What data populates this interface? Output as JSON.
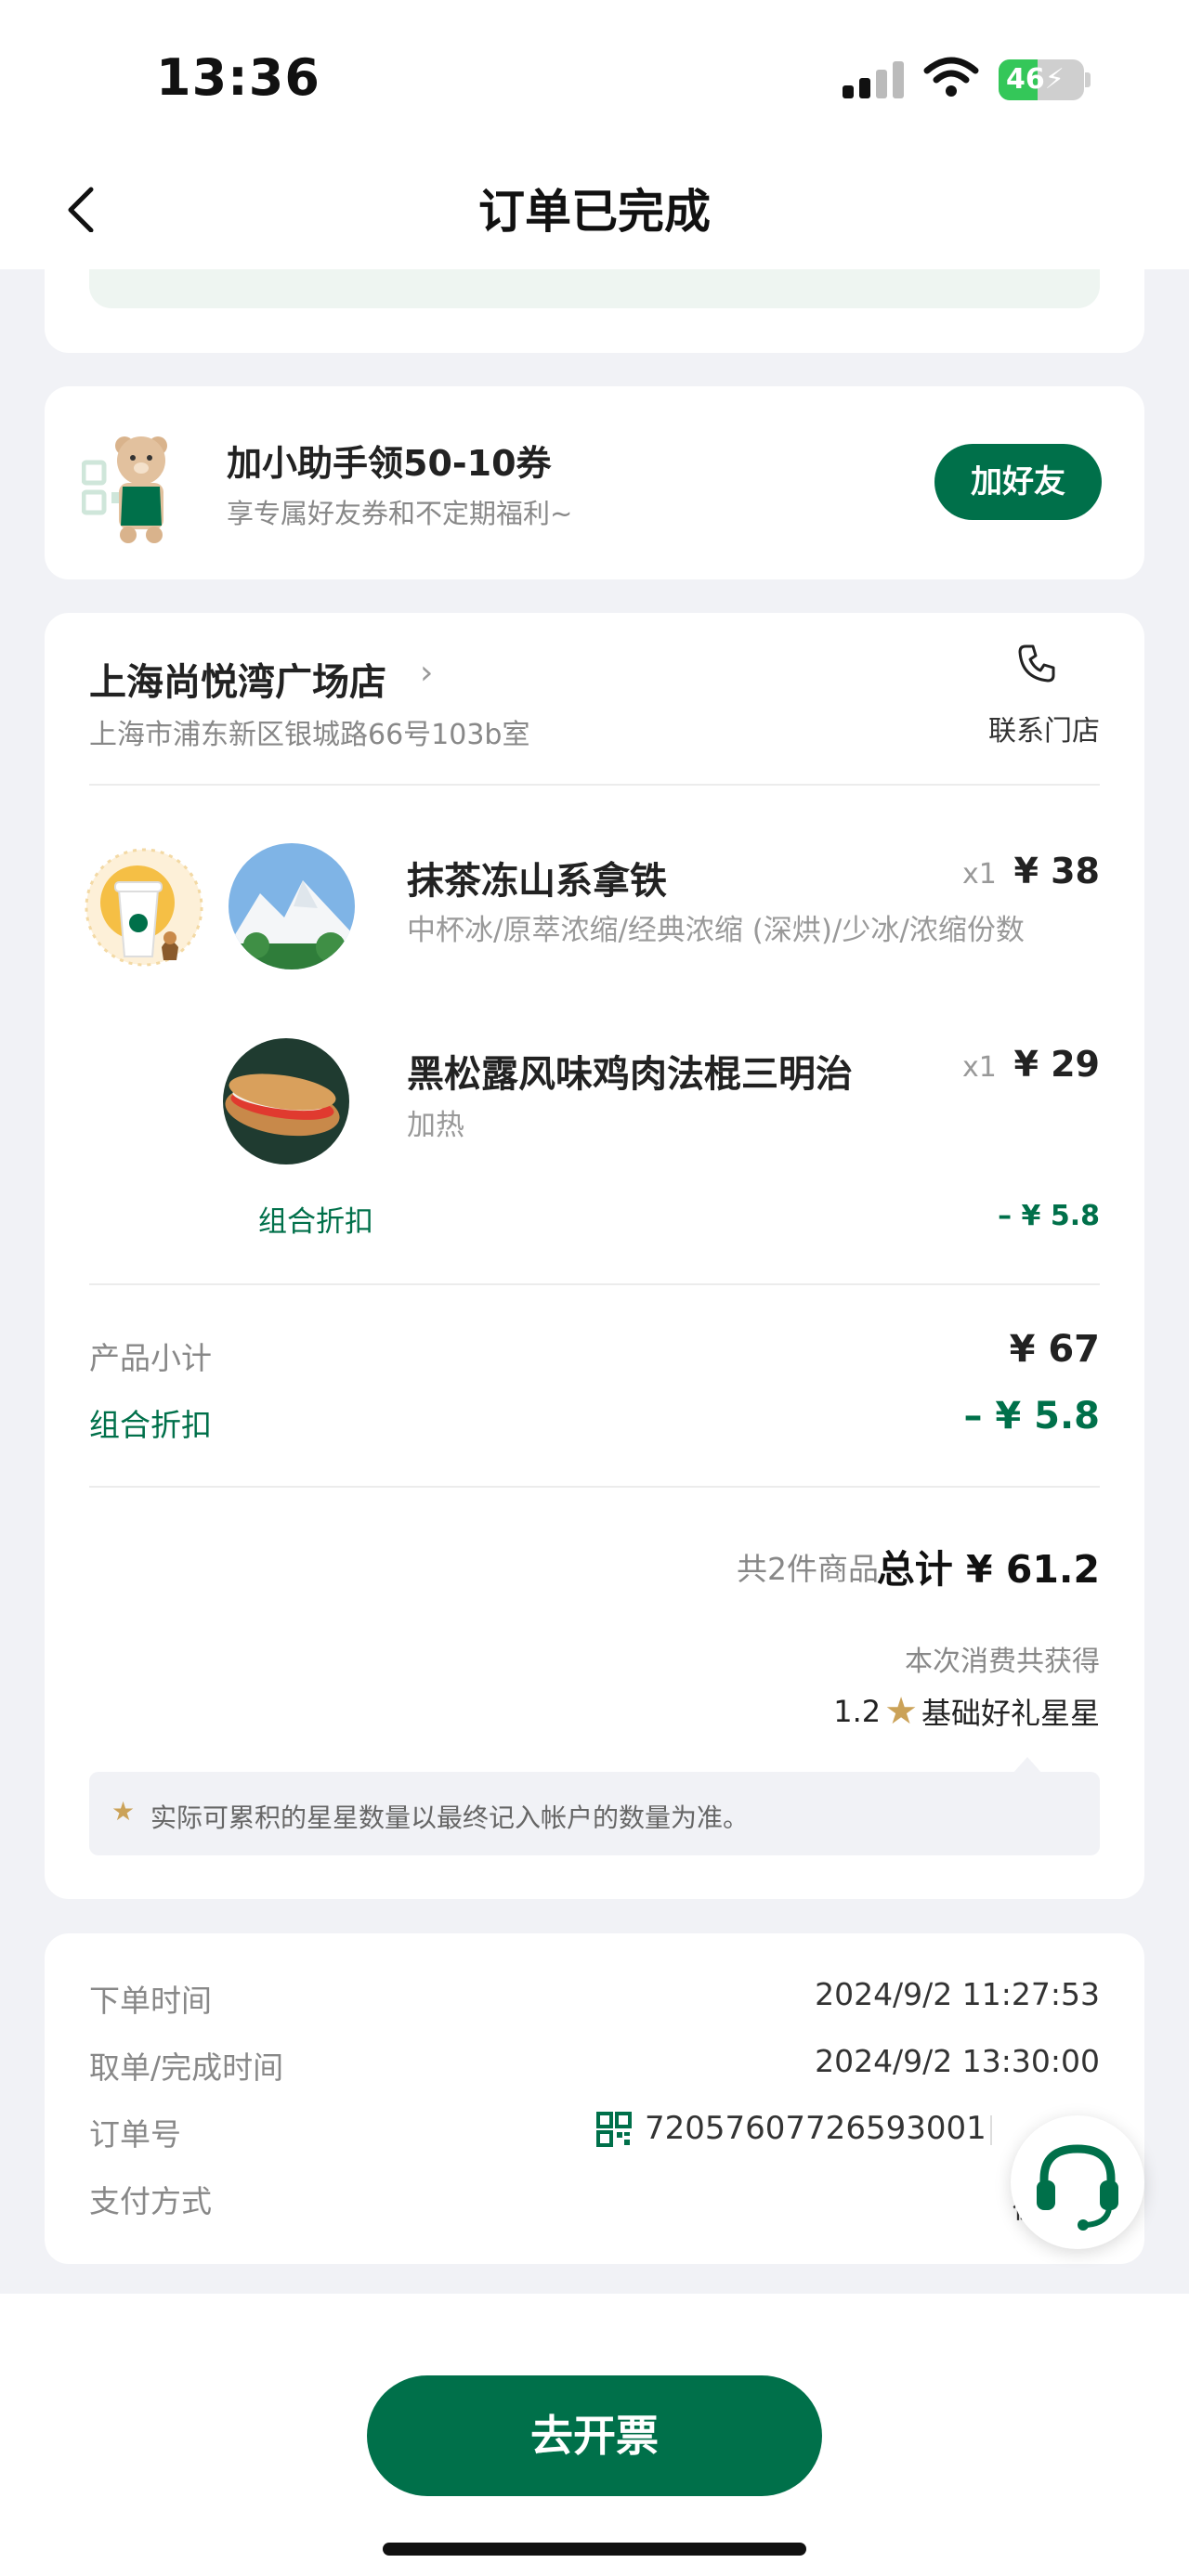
{
  "status_bar": {
    "time": "13:36",
    "battery": "46",
    "battery_level": 0.46
  },
  "nav": {
    "title": "订单已完成"
  },
  "helper": {
    "title": "加小助手领50-10券",
    "subtitle": "享专属好友券和不定期福利~",
    "button": "加好友"
  },
  "store": {
    "name": "上海尚悦湾广场店",
    "address": "上海市浦东新区银城路66号103b室",
    "contact_label": "联系门店"
  },
  "items": [
    {
      "name": "抹茶冻山系拿铁",
      "qty": "x1",
      "price": "¥ 38",
      "spec": "中杯冰/原萃浓缩/经典浓缩 (深烘)/少冰/浓缩份数"
    },
    {
      "name": "黑松露风味鸡肉法棍三明治",
      "qty": "x1",
      "price": "¥ 29",
      "spec": "加热"
    }
  ],
  "combo": {
    "label": "组合折扣",
    "value": "– ¥ 5.8"
  },
  "summary": {
    "subtotal_label": "产品小计",
    "subtotal_value": "¥ 67",
    "discount_label": "组合折扣",
    "discount_value": "– ¥ 5.8",
    "count_text": "共2件商品",
    "total_text": "总计 ¥ 61.2",
    "earn_label": "本次消费共获得",
    "stars_value": "1.2",
    "stars_label": "基础好礼星星",
    "notice": "实际可累积的星星数量以最终记入帐户的数量为准。"
  },
  "order_info": {
    "order_time_label": "下单时间",
    "order_time_value": "2024/9/2 11:27:53",
    "complete_time_label": "取单/完成时间",
    "complete_time_value": "2024/9/2 13:30:00",
    "order_no_label": "订单号",
    "order_no_value": "72057607726593001",
    "payment_label": "支付方式",
    "payment_value_partial": "微"
  },
  "bottom": {
    "invoice_button": "去开票"
  },
  "colors": {
    "brand_green": "#00704a",
    "star_gold": "#cba258",
    "background": "#f1f2f6"
  },
  "icons": [
    "back-chevron-icon",
    "phone-icon",
    "qr-code-icon",
    "customer-service-headset-icon",
    "star-icon",
    "wifi-icon",
    "signal-icon",
    "battery-icon"
  ]
}
